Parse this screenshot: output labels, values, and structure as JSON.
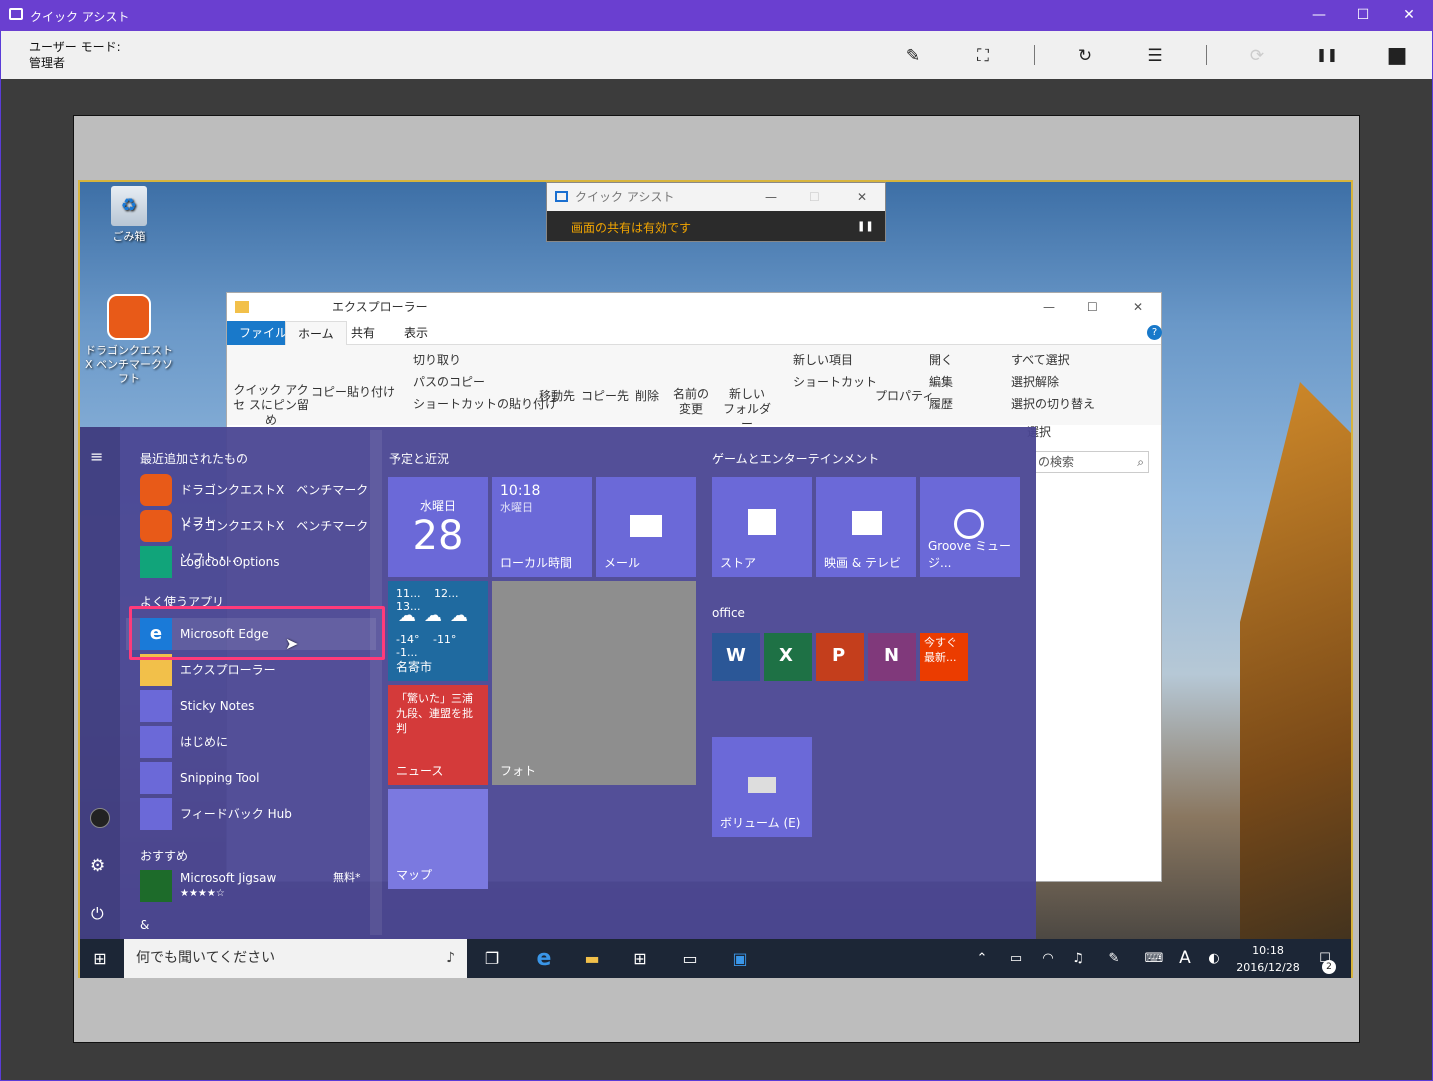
{
  "window": {
    "title": "クイック アシスト",
    "minimize": "—",
    "maximize": "☐",
    "close": "✕"
  },
  "toolbar": {
    "user_mode_label": "ユーザー モード:",
    "user_mode_value": "管理者",
    "annotate": "✎",
    "fit": "⛶",
    "restart": "↻",
    "taskmgr": "☰",
    "reconnect": "⟳",
    "pause": "❚❚",
    "stop": "■"
  },
  "desktop": {
    "recycle_bin": "ごみ箱",
    "game_shortcut": "ドラゴンクエストⅩ ベンチマークソフト"
  },
  "mini_assist": {
    "title": "クイック アシスト",
    "status": "画面の共有は有効です",
    "pause": "❚❚"
  },
  "explorer": {
    "title": "エクスプローラー",
    "tabs": [
      "ファイル",
      "ホーム",
      "共有",
      "表示"
    ],
    "ribbon": {
      "pin": "クイック アクセ スにピン留め",
      "copy": "コピー",
      "paste": "貼り付け",
      "cut": "切り取り",
      "copy_path": "パスのコピー",
      "paste_shortcut": "ショートカットの貼り付け",
      "move_to": "移動先",
      "copy_to": "コピー先",
      "delete": "削除",
      "rename": "名前の 変更",
      "new_folder": "新しい フォルダー",
      "new_item": "新しい項目",
      "shortcut": "ショートカット",
      "properties": "プロパティ",
      "open": "開く",
      "edit": "編集",
      "history": "履歴",
      "select_all": "すべて選択",
      "select_none": "選択解除",
      "invert_selection": "選択の切り替え",
      "select_group": "選択"
    },
    "search_placeholder": "の検索"
  },
  "start": {
    "recent_header": "最近追加されたもの",
    "frequent_header": "よく使うアプリ",
    "recommended_header": "おすすめ",
    "letter": "&",
    "apps": [
      "ドラゴンクエストⅩ　ベンチマークソフト",
      "ドラゴンクエストⅩ　ベンチマークソフト・...",
      "Logicool Options",
      "Microsoft Edge",
      "エクスプローラー",
      "Sticky Notes",
      "はじめに",
      "Snipping Tool",
      "フィードバック Hub"
    ],
    "jigsaw": "Microsoft Jigsaw",
    "jigsaw_price": "無料*",
    "jigsaw_stars": "★★★★☆",
    "group1": "予定と近況",
    "group2": "ゲームとエンターテインメント",
    "group3": "office",
    "calendar_day": "水曜日",
    "calendar_date": "28",
    "clock_time": "10:18",
    "clock_day": "水曜日",
    "clock_label": "ローカル時間",
    "mail": "メール",
    "weather_days": [
      "11...",
      "12...",
      "13..."
    ],
    "weather_temps": [
      "-14°",
      "-11°",
      "-1..."
    ],
    "weather_city": "名寄市",
    "news_text": "「驚いた」三浦九段、連盟を批判",
    "news_label": "ニュース",
    "photos": "フォト",
    "maps": "マップ",
    "store": "ストア",
    "movies": "映画 & テレビ",
    "groove": "Groove ミュージ...",
    "update": "今すぐ最新...",
    "volume": "ボリューム (E)"
  },
  "taskbar": {
    "search_placeholder": "何でも聞いてください",
    "time": "10:18",
    "date": "2016/12/28",
    "ime": "A",
    "notif_count": "2"
  },
  "colors": {
    "accent": "#6a3fd0",
    "tile": "#6b69d8",
    "highlight": "#ff3b7a"
  }
}
